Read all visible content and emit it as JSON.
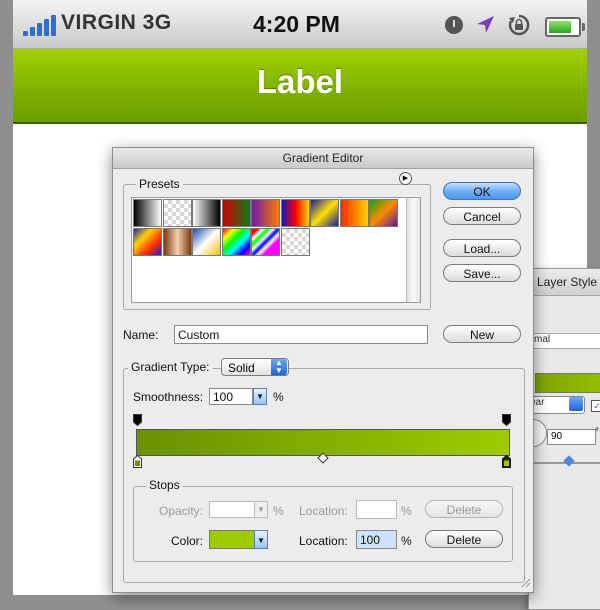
{
  "status_bar": {
    "carrier": "VIRGIN 3G",
    "time": "4:20 PM",
    "icons": [
      "signal-bars-icon",
      "clock-icon",
      "location-arrow-icon",
      "rotation-lock-icon",
      "battery-icon"
    ],
    "battery_level": 0.85
  },
  "nav_bar": {
    "title": "Label",
    "color": "#8dc000"
  },
  "layer_style": {
    "title": "Layer Style",
    "blend_mode": "mal",
    "style": "ear",
    "angle": "90",
    "degree_symbol": "°"
  },
  "gradient_editor": {
    "title": "Gradient Editor",
    "presets": {
      "legend": "Presets",
      "menu_icon": "triangle-right-icon",
      "swatches": [
        "linear-gradient(90deg,#000,#fff)",
        "transparent-checker",
        "linear-gradient(90deg,#fff,#000)",
        "linear-gradient(90deg,#d40000,#0a7a1a)",
        "linear-gradient(90deg,#6a1aa8,#ff7a00)",
        "linear-gradient(90deg,#1414b8,#ff0000,#ffd400)",
        "linear-gradient(135deg,#1a1aa0,#ffe000,#1a1aa0)",
        "linear-gradient(90deg,#ff2a00,#ffd000)",
        "linear-gradient(135deg,#1aa010,#ff8a00,#5a1aa0)",
        "linear-gradient(135deg,#2020c0,#ffd000,#ff3000,#2020c0)",
        "linear-gradient(90deg,#7a3a12,#f4d0b0,#7a3a12)",
        "linear-gradient(135deg,#1a4ab0,#fff,#f4c000)",
        "linear-gradient(135deg,#ff0000,#ffff00,#00ff00,#00ffff,#0000ff,#ff00ff)",
        "linear-gradient(135deg,#ff0000 10%,#fff 20%,#00ff00 30%,#fff 40%,#0000ff 50%,#fff 60%,#ff00ff 70%)",
        "transparent-checker"
      ]
    },
    "buttons": {
      "ok": "OK",
      "cancel": "Cancel",
      "load": "Load...",
      "save": "Save...",
      "new": "New"
    },
    "name": {
      "label": "Name:",
      "value": "Custom"
    },
    "gradient_type": {
      "label": "Gradient Type:",
      "value": "Solid"
    },
    "smoothness": {
      "label": "Smoothness:",
      "value": "100",
      "unit": "%"
    },
    "gradient": {
      "start_color": "#6a9100",
      "end_color": "#9ccc00"
    },
    "stops": {
      "legend": "Stops",
      "opacity": {
        "label": "Opacity:",
        "value": "",
        "unit": "%",
        "location_label": "Location:",
        "location_value": "",
        "location_unit": "%",
        "delete": "Delete"
      },
      "color": {
        "label": "Color:",
        "swatch": "#9ccc00",
        "location_label": "Location:",
        "location_value": "100",
        "location_unit": "%",
        "delete": "Delete"
      }
    }
  }
}
